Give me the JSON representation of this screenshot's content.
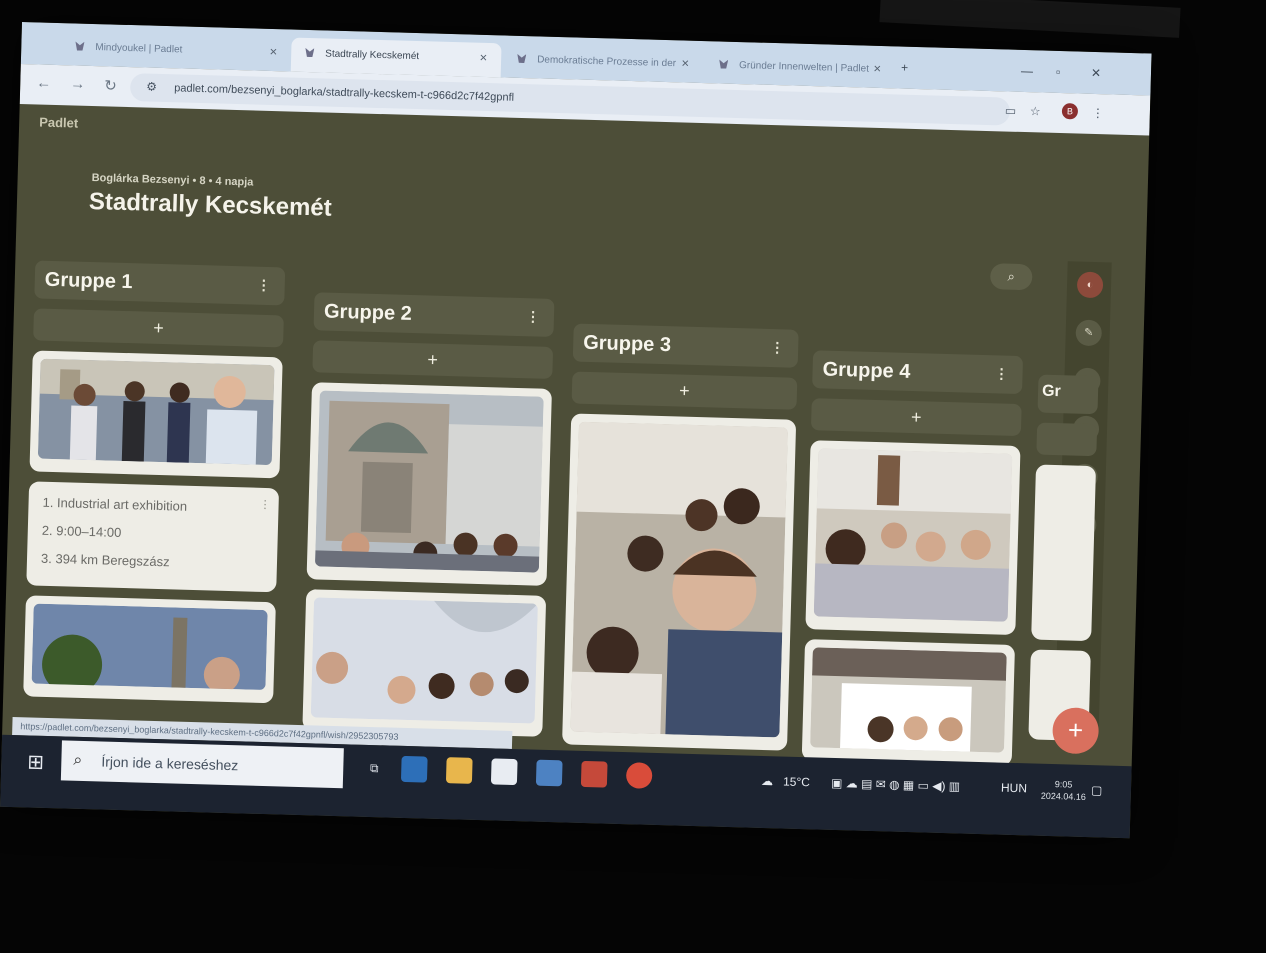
{
  "browser": {
    "tabs": [
      {
        "label": "Mindyoukel | Padlet",
        "active": false
      },
      {
        "label": "Stadtrally Kecskemét",
        "active": true
      },
      {
        "label": "Demokratische Prozesse in der",
        "active": false
      },
      {
        "label": "Gründer Innenwelten | Padlet",
        "active": false
      }
    ],
    "url": "padlet.com/bezsenyi_boglarka/stadtrally-kecskem-t-c966d2c7f42gpnfl"
  },
  "board": {
    "logo": "Padlet",
    "meta": "Boglárka Bezsenyi • 8 • 4 napja",
    "title": "Stadtrally Kecskemét",
    "add_label": "+",
    "kebab": "⋮",
    "columns": [
      {
        "title": "Gruppe 1"
      },
      {
        "title": "Gruppe 2"
      },
      {
        "title": "Gruppe 3"
      },
      {
        "title": "Gruppe 4"
      },
      {
        "title": "Gr"
      }
    ],
    "text_post": [
      "1. Industrial art exhibition",
      "2. 9:00–14:00",
      "3. 394 km Beregszász"
    ]
  },
  "status_tooltip": "https://padlet.com/bezsenyi_boglarka/stadtrally-kecskem-t-c966d2c7f42gpnfl/wish/2952305793",
  "taskbar": {
    "search_placeholder": "Írjon ide a kereséshez",
    "weather": "15°C",
    "lang": "HUN",
    "time": "9:05",
    "date": "2024.04.16"
  },
  "icons": [
    "padlet-icon",
    "search-icon",
    "kebab-icon",
    "plus-icon",
    "windows-start-icon",
    "cloud-icon"
  ]
}
